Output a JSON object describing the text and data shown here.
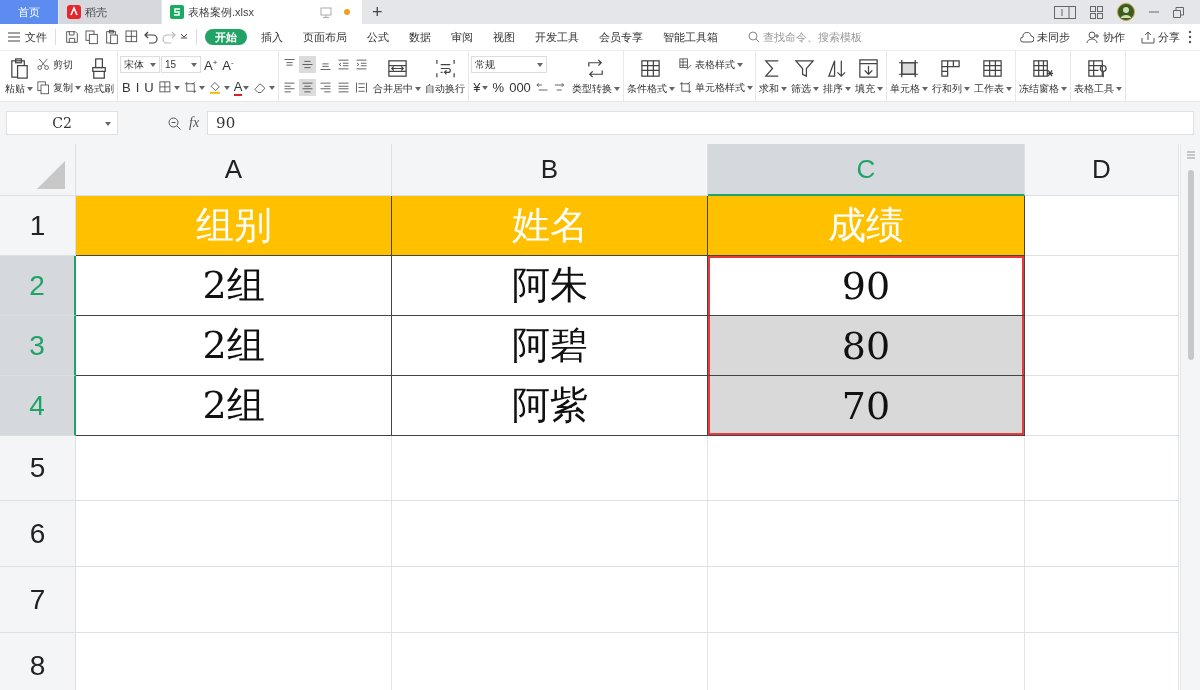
{
  "tabs": [
    {
      "label": "首页",
      "kind": "home",
      "selected": false
    },
    {
      "label": "稻壳",
      "kind": "docer",
      "selected": false
    },
    {
      "label": "表格案例.xlsx",
      "kind": "file",
      "selected": true,
      "unsaved": true
    }
  ],
  "new_tab": "+",
  "menu": {
    "file": "文件",
    "ribbon_tabs": [
      {
        "label": "开始",
        "selected": true
      },
      {
        "label": "插入",
        "selected": false
      },
      {
        "label": "页面布局",
        "selected": false
      },
      {
        "label": "公式",
        "selected": false
      },
      {
        "label": "数据",
        "selected": false
      },
      {
        "label": "审阅",
        "selected": false
      },
      {
        "label": "视图",
        "selected": false
      },
      {
        "label": "开发工具",
        "selected": false
      },
      {
        "label": "会员专享",
        "selected": false
      },
      {
        "label": "智能工具箱",
        "selected": false
      }
    ],
    "search": {
      "placeholder": "查找命令、搜索模板"
    },
    "actions": [
      "未同步",
      "协作",
      "分享"
    ]
  },
  "toolbar": {
    "groups": [
      {
        "columns": [
          {
            "kind": "big",
            "label": "粘贴",
            "dropdown": true
          },
          {
            "kind": "stack",
            "rows": [
              {
                "items": [
                  {
                    "kind": "small",
                    "label": "剪切",
                    "dropdown": false
                  }
                ]
              },
              {
                "items": [
                  {
                    "kind": "small",
                    "label": "复制",
                    "dropdown": true
                  }
                ]
              }
            ]
          },
          {
            "kind": "big",
            "label": "格式刷",
            "dropdown": false
          }
        ]
      },
      {
        "columns": [
          {
            "kind": "stack",
            "rows": [
              {
                "items": [
                  {
                    "kind": "select",
                    "value": "宋体"
                  },
                  {
                    "kind": "select",
                    "value": "15"
                  },
                  {
                    "kind": "glyph",
                    "label": "A$^{+}$",
                    "dropdown": false
                  },
                  {
                    "kind": "glyph",
                    "label": "A$^{-}$",
                    "dropdown": false
                  }
                ]
              },
              {
                "items": [
                  {
                    "kind": "glyph",
                    "label": "B",
                    "dropdown": false
                  },
                  {
                    "kind": "glyph",
                    "label": "I",
                    "dropdown": false
                  },
                  {
                    "kind": "glyph",
                    "label": "U",
                    "dropdown": false
                  },
                  {
                    "kind": "icon",
                    "dropdown": true
                  },
                  {
                    "kind": "icon",
                    "dropdown": true
                  },
                  {
                    "kind": "icon",
                    "dropdown": true
                  },
                  {
                    "kind": "glyph",
                    "label": "A",
                    "color": "#e02020",
                    "dropdown": true
                  },
                  {
                    "kind": "icon",
                    "dropdown": true
                  }
                ]
              }
            ]
          }
        ]
      },
      {
        "columns": [
          {
            "kind": "stack",
            "rows": [
              {
                "items": [
                  {
                    "kind": "icon",
                    "on": false
                  },
                  {
                    "kind": "icon",
                    "on": true
                  },
                  {
                    "kind": "icon",
                    "on": false
                  },
                  {
                    "kind": "icon",
                    "on": false
                  },
                  {
                    "kind": "icon",
                    "on": false
                  }
                ]
              },
              {
                "items": [
                  {
                    "kind": "icon",
                    "on": false
                  },
                  {
                    "kind": "icon",
                    "on": true
                  },
                  {
                    "kind": "icon",
                    "on": false
                  },
                  {
                    "kind": "icon",
                    "on": false
                  },
                  {
                    "kind": "icon",
                    "on": false
                  }
                ]
              }
            ]
          },
          {
            "kind": "big",
            "label": "合并居中",
            "dropdown": true
          },
          {
            "kind": "big",
            "label": "自动换行",
            "dropdown": false
          }
        ]
      },
      {
        "columns": [
          {
            "kind": "stack",
            "rows": [
              {
                "items": [
                  {
                    "kind": "select",
                    "value": "常规"
                  }
                ]
              },
              {
                "items": [
                  {
                    "kind": "glyph",
                    "label": "¥",
                    "dropdown": true
                  },
                  {
                    "kind": "glyph",
                    "label": "%",
                    "dropdown": false
                  },
                  {
                    "kind": "glyph",
                    "label": "000",
                    "dropdown": false
                  },
                  {
                    "kind": "icon",
                    "dropdown": false
                  },
                  {
                    "kind": "icon",
                    "dropdown": false
                  }
                ]
              }
            ]
          },
          {
            "kind": "big",
            "label": "类型转换",
            "dropdown": true
          }
        ]
      },
      {
        "columns": [
          {
            "kind": "big",
            "label": "条件格式",
            "dropdown": true
          },
          {
            "kind": "stack",
            "rows": [
              {
                "items": [
                  {
                    "kind": "small",
                    "label": "表格样式",
                    "dropdown": true
                  }
                ]
              },
              {
                "items": [
                  {
                    "kind": "small",
                    "label": "单元格样式",
                    "dropdown": true
                  }
                ]
              }
            ]
          }
        ]
      },
      {
        "columns": [
          {
            "kind": "big",
            "label": "求和",
            "dropdown": true
          },
          {
            "kind": "big",
            "label": "筛选",
            "dropdown": true
          },
          {
            "kind": "big",
            "label": "排序",
            "dropdown": true
          },
          {
            "kind": "big",
            "label": "填充",
            "dropdown": true
          }
        ]
      },
      {
        "columns": [
          {
            "kind": "big",
            "label": "单元格",
            "dropdown": true
          },
          {
            "kind": "big",
            "label": "行和列",
            "dropdown": true
          },
          {
            "kind": "big",
            "label": "工作表",
            "dropdown": true
          }
        ]
      },
      {
        "columns": [
          {
            "kind": "big",
            "label": "冻结窗格",
            "dropdown": true
          }
        ]
      },
      {
        "columns": [
          {
            "kind": "big",
            "label": "表格工具",
            "dropdown": true
          }
        ]
      }
    ]
  },
  "formula_bar": {
    "name_box": "C2",
    "fx": "fx",
    "value": "90"
  },
  "sheet": {
    "columns": [
      {
        "label": "A",
        "selected": false
      },
      {
        "label": "B",
        "selected": false
      },
      {
        "label": "C",
        "selected": true
      },
      {
        "label": "D",
        "selected": false
      }
    ],
    "rows": [
      {
        "label": "1",
        "selected": false,
        "kind": "header",
        "cells": [
          {
            "text": "组别",
            "selected": false
          },
          {
            "text": "姓名",
            "selected": false
          },
          {
            "text": "成绩",
            "selected": false
          }
        ]
      },
      {
        "label": "2",
        "selected": true,
        "kind": "data",
        "cells": [
          {
            "text": "2组",
            "selected": false
          },
          {
            "text": "阿朱",
            "selected": false
          },
          {
            "text": "90",
            "selected": true,
            "active": true
          }
        ]
      },
      {
        "label": "3",
        "selected": true,
        "kind": "data",
        "cells": [
          {
            "text": "2组",
            "selected": false
          },
          {
            "text": "阿碧",
            "selected": false
          },
          {
            "text": "80",
            "selected": true,
            "active": false
          }
        ]
      },
      {
        "label": "4",
        "selected": true,
        "kind": "data",
        "cells": [
          {
            "text": "2组",
            "selected": false
          },
          {
            "text": "阿紫",
            "selected": false
          },
          {
            "text": "70",
            "selected": true,
            "active": false
          }
        ]
      },
      {
        "label": "5",
        "selected": false,
        "kind": "empty"
      },
      {
        "label": "6",
        "selected": false,
        "kind": "empty"
      },
      {
        "label": "7",
        "selected": false,
        "kind": "empty"
      },
      {
        "label": "8",
        "selected": false,
        "kind": "empty"
      }
    ]
  }
}
